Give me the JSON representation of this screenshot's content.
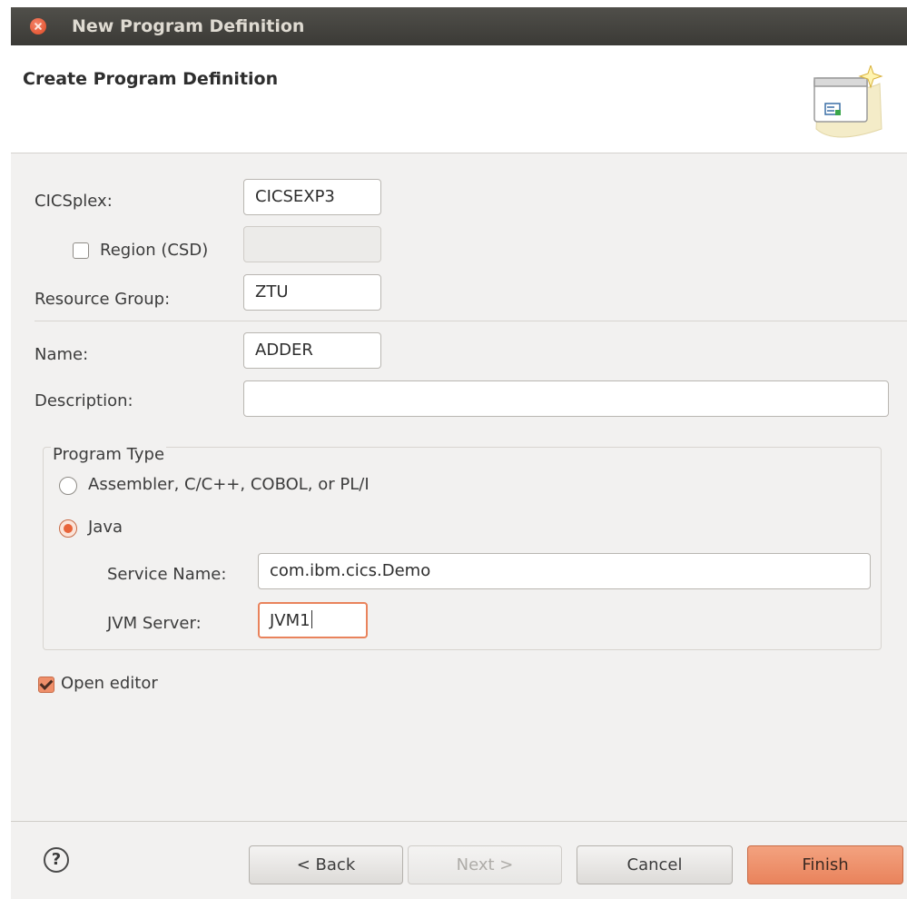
{
  "window": {
    "title": "New Program Definition"
  },
  "banner": {
    "title": "Create Program Definition",
    "icon": "wizard-banner-icon"
  },
  "form": {
    "cicsplex": {
      "label": "CICSplex:",
      "value": "CICSEXP3"
    },
    "region": {
      "label": "Region (CSD)",
      "checked": false,
      "value": ""
    },
    "resource_group": {
      "label": "Resource Group:",
      "value": "ZTU"
    },
    "name": {
      "label": "Name:",
      "value": "ADDER"
    },
    "description": {
      "label": "Description:",
      "value": ""
    },
    "program_type": {
      "title": "Program Type",
      "options": [
        {
          "label": "Assembler, C/C++, COBOL, or PL/I",
          "selected": false
        },
        {
          "label": "Java",
          "selected": true
        }
      ],
      "service_name": {
        "label": "Service Name:",
        "value": "com.ibm.cics.Demo"
      },
      "jvm_server": {
        "label": "JVM Server:",
        "value": "JVM1"
      }
    },
    "open_editor": {
      "label": "Open editor",
      "checked": true
    }
  },
  "buttons": {
    "help": "?",
    "back": "< Back",
    "next": "Next >",
    "cancel": "Cancel",
    "finish": "Finish"
  },
  "colors": {
    "accent": "#e9835c",
    "titlebar": "#3b3a36",
    "dialog_bg": "#f2f1f0"
  }
}
